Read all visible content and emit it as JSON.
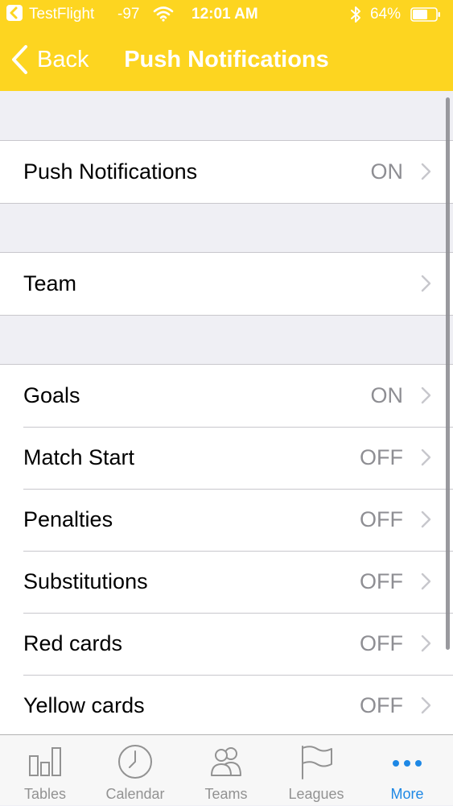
{
  "status_bar": {
    "carrier": "TestFlight",
    "signal": "-97",
    "time": "12:01 AM",
    "battery": "64%",
    "icons": [
      "back-to-app-icon",
      "wifi-icon",
      "bluetooth-icon",
      "battery-icon"
    ]
  },
  "nav": {
    "back_label": "Back",
    "title": "Push Notifications"
  },
  "sections": [
    {
      "rows": [
        {
          "label": "Push Notifications",
          "value": "ON"
        }
      ]
    },
    {
      "rows": [
        {
          "label": "Team",
          "value": ""
        }
      ]
    },
    {
      "rows": [
        {
          "label": "Goals",
          "value": "ON"
        },
        {
          "label": "Match Start",
          "value": "OFF"
        },
        {
          "label": "Penalties",
          "value": "OFF"
        },
        {
          "label": "Substitutions",
          "value": "OFF"
        },
        {
          "label": "Red cards",
          "value": "OFF"
        },
        {
          "label": "Yellow cards",
          "value": "OFF"
        }
      ]
    }
  ],
  "tab_bar": {
    "tabs": [
      {
        "label": "Tables",
        "icon": "bar-chart-icon",
        "active": false
      },
      {
        "label": "Calendar",
        "icon": "clock-icon",
        "active": false
      },
      {
        "label": "Teams",
        "icon": "people-icon",
        "active": false
      },
      {
        "label": "Leagues",
        "icon": "flag-icon",
        "active": false
      },
      {
        "label": "More",
        "icon": "more-dots-icon",
        "active": true
      }
    ]
  },
  "colors": {
    "header": "#fdd520",
    "active_tab": "#1e88e5",
    "inactive_tab": "#929292",
    "secondary_text": "#8e8e93"
  }
}
